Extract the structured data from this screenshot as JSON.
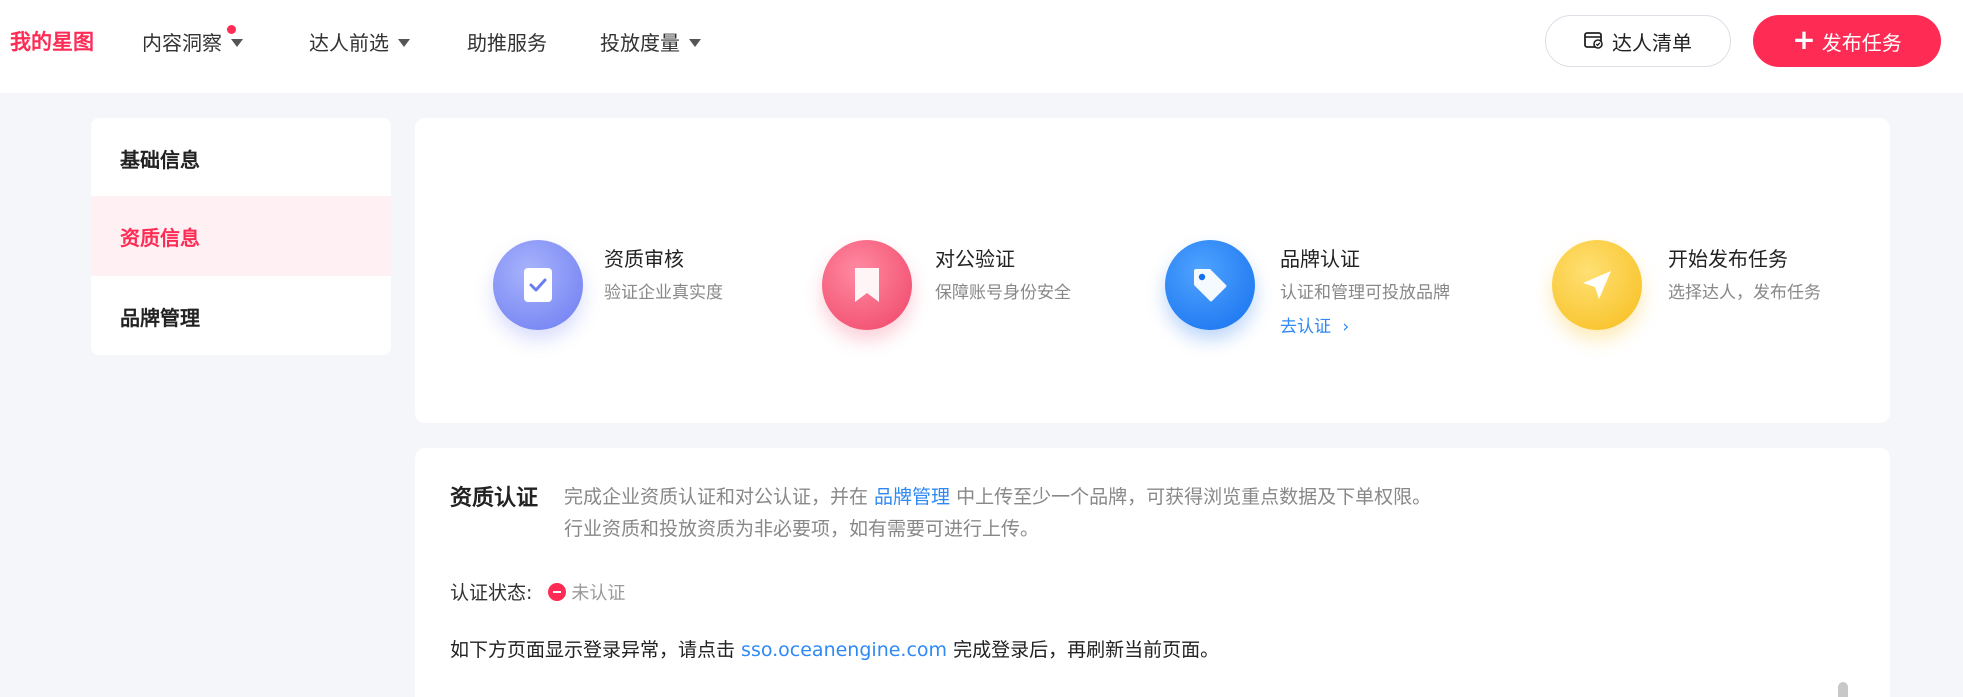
{
  "topbar": {
    "logo": "我的星图",
    "nav": [
      {
        "label": "内容洞察",
        "has_dropdown": true,
        "has_dot": true
      },
      {
        "label": "达人前选",
        "has_dropdown": true
      },
      {
        "label": "助推服务",
        "has_dropdown": false
      },
      {
        "label": "投放度量",
        "has_dropdown": true
      }
    ],
    "talent_list_label": "达人清单",
    "publish_task_label": "发布任务"
  },
  "sidebar": {
    "items": [
      {
        "label": "基础信息",
        "active": false
      },
      {
        "label": "资质信息",
        "active": true
      },
      {
        "label": "品牌管理",
        "active": false
      }
    ]
  },
  "steps": [
    {
      "title": "资质审核",
      "desc": "验证企业真实度",
      "icon": "check-document-icon",
      "color": "#7f8ff7"
    },
    {
      "title": "对公验证",
      "desc": "保障账号身份安全",
      "icon": "bookmark-icon",
      "color": "#f5587a"
    },
    {
      "title": "品牌认证",
      "desc": "认证和管理可投放品牌",
      "link": "去认证",
      "icon": "tag-icon",
      "color": "#1f7ef5"
    },
    {
      "title": "开始发布任务",
      "desc": "选择达人，发布任务",
      "icon": "send-icon",
      "color": "#fcc93a"
    }
  ],
  "qualification": {
    "title": "资质认证",
    "line1_before": "完成企业资质认证和对公认证，并在 ",
    "line1_link": "品牌管理",
    "line1_after": " 中上传至少一个品牌，可获得浏览重点数据及下单权限。",
    "line2": "行业资质和投放资质为非必要项，如有需要可进行上传。",
    "status_label": "认证状态:",
    "status_value": "未认证",
    "notice_before": "如下方页面显示登录异常，请点击 ",
    "notice_link": "sso.oceanengine.com",
    "notice_after": " 完成登录后，再刷新当前页面。"
  },
  "colors": {
    "brand": "#fe2c55",
    "link": "#2f89f5",
    "active_bg": "#fff0f3"
  }
}
